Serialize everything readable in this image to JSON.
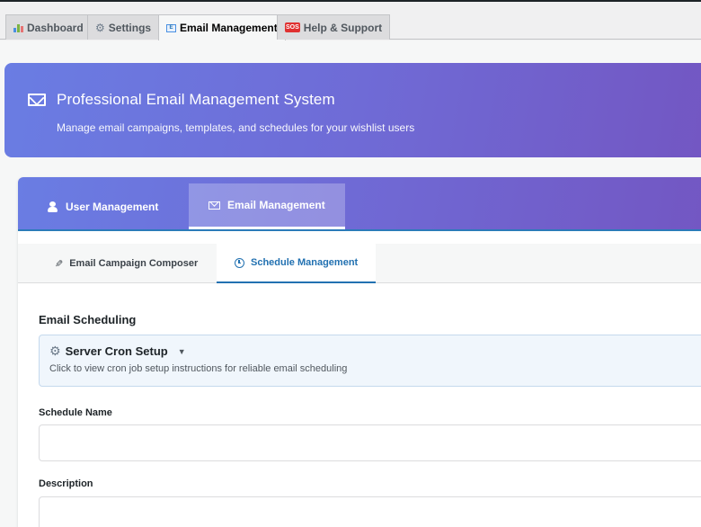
{
  "top_tabs": [
    {
      "label": "Dashboard",
      "icon": "bar-chart-icon"
    },
    {
      "label": "Settings",
      "icon": "gear-icon"
    },
    {
      "label": "Email Management",
      "icon": "email-icon",
      "active": true
    },
    {
      "label": "Help & Support",
      "icon": "sos-icon"
    }
  ],
  "hero": {
    "title": "Professional Email Management System",
    "subtitle": "Manage email campaigns, templates, and schedules for your wishlist users"
  },
  "section_tabs": [
    {
      "label": "User Management",
      "icon": "users-icon"
    },
    {
      "label": "Email Management",
      "icon": "envelope-icon",
      "active": true
    }
  ],
  "sub_tabs": [
    {
      "label": "Email Campaign Composer",
      "icon": "pencil-icon"
    },
    {
      "label": "Schedule Management",
      "icon": "clock-icon",
      "active": true
    }
  ],
  "form": {
    "heading": "Email Scheduling",
    "cron": {
      "title": "Server Cron Setup",
      "caret": "▼",
      "subtitle": "Click to view cron job setup instructions for reliable email scheduling"
    },
    "schedule_name": {
      "label": "Schedule Name",
      "value": "",
      "placeholder": ""
    },
    "description": {
      "label": "Description",
      "value": "",
      "placeholder": ""
    }
  },
  "colors": {
    "accent": "#2271b1",
    "gradient_start": "#6a7de3",
    "gradient_end": "#7356c2"
  }
}
